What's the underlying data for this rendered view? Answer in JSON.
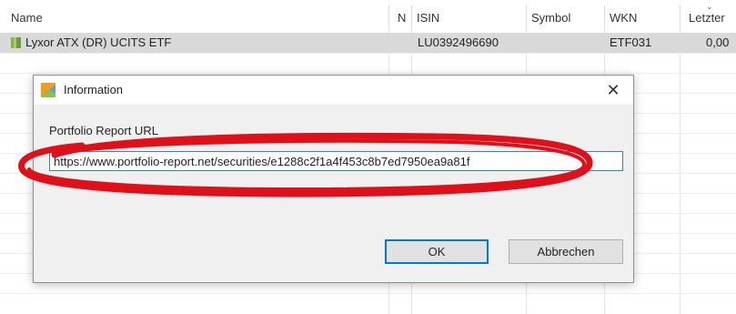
{
  "table": {
    "columns": [
      "Name",
      "N",
      "ISIN",
      "Symbol",
      "WKN",
      "Letzter"
    ],
    "sort_glyph": "⌄",
    "rows": [
      {
        "name": "Lyxor ATX (DR) UCITS ETF",
        "isin": "LU0392496690",
        "symbol": "",
        "wkn": "ETF031",
        "letzter": "0,00"
      }
    ]
  },
  "dialog": {
    "title": "Information",
    "close_glyph": "✕",
    "field_label": "Portfolio Report URL",
    "url_value": "https://www.portfolio-report.net/securities/e1288c2f1a4f453c8b7ed7950ea9a81f",
    "ok_label": "OK",
    "cancel_label": "Abbrechen"
  },
  "colors": {
    "selection_row": "#d9d9d9",
    "dialog_bg": "#f0f0f0",
    "focus_border": "#3d7bd8",
    "annotation": "#e0101a"
  },
  "icons": {
    "security": "security-icon",
    "dialog": "app-chart-icon"
  }
}
